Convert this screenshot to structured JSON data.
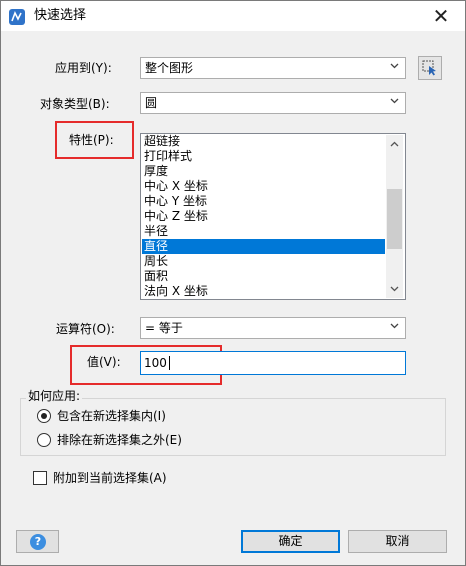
{
  "window": {
    "title": "快速选择",
    "close_glyph": "✕"
  },
  "apply_to": {
    "label": "应用到(Y):",
    "value": "整个图形"
  },
  "object_type": {
    "label": "对象类型(B):",
    "value": "圆"
  },
  "properties": {
    "label": "特性(P):",
    "items": [
      "超链接",
      "打印样式",
      "厚度",
      "中心 X 坐标",
      "中心 Y 坐标",
      "中心 Z 坐标",
      "半径",
      "直径",
      "周长",
      "面积",
      "法向 X 坐标"
    ],
    "selected_index": 7
  },
  "operator": {
    "label": "运算符(O):",
    "value": "= 等于"
  },
  "value_field": {
    "label": "值(V):",
    "value": "100"
  },
  "how_to_apply": {
    "label": "如何应用:",
    "include": "包含在新选择集内(I)",
    "exclude": "排除在新选择集之外(E)",
    "selected": "include"
  },
  "append": {
    "label": "附加到当前选择集(A)",
    "checked": false
  },
  "buttons": {
    "ok": "确定",
    "cancel": "取消",
    "help_glyph": "?"
  },
  "colors": {
    "accent": "#0078d7",
    "highlight": "#e52b2b"
  }
}
